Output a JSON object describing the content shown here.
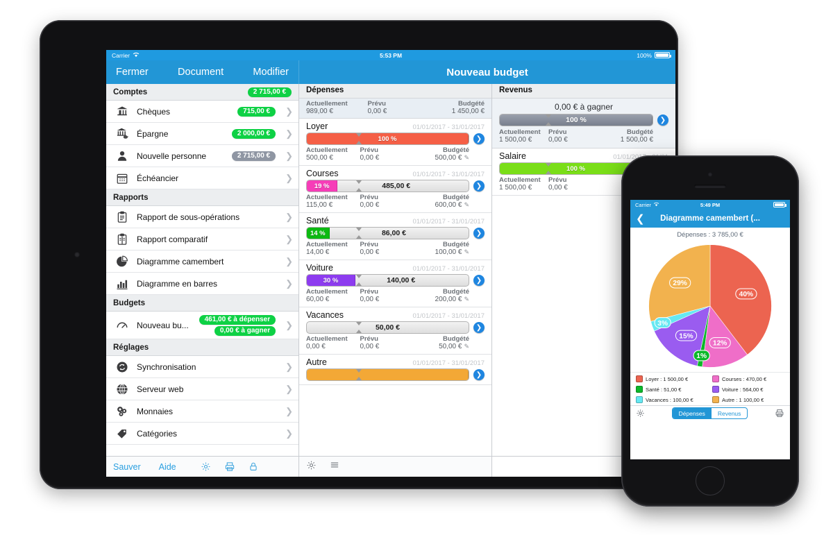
{
  "ipad": {
    "statusbar": {
      "carrier": "Carrier",
      "time": "5:53 PM",
      "battery": "100%"
    },
    "navbar": {
      "close": "Fermer",
      "document": "Document",
      "edit": "Modifier",
      "title": "Nouveau budget"
    },
    "sidebar": {
      "sections": [
        {
          "title": "Comptes",
          "badge": "2 715,00 €",
          "rows": [
            {
              "icon": "bank-icon",
              "label": "Chèques",
              "badge": "715,00 €",
              "badge_color": "green"
            },
            {
              "icon": "savings-icon",
              "label": "Épargne",
              "badge": "2 000,00 €",
              "badge_color": "green"
            },
            {
              "icon": "person-icon",
              "label": "Nouvelle personne",
              "badge": "2 715,00 €",
              "badge_color": "grey"
            },
            {
              "icon": "calendar-icon",
              "label": "Échéancier",
              "badge": "",
              "badge_color": ""
            }
          ]
        },
        {
          "title": "Rapports",
          "badge": "",
          "rows": [
            {
              "icon": "clipboard-icon",
              "label": "Rapport de sous-opérations",
              "badge": "",
              "badge_color": ""
            },
            {
              "icon": "clipboard-compare-icon",
              "label": "Rapport comparatif",
              "badge": "",
              "badge_color": ""
            },
            {
              "icon": "pie-chart-icon",
              "label": "Diagramme camembert",
              "badge": "",
              "badge_color": ""
            },
            {
              "icon": "bar-chart-icon",
              "label": "Diagramme en barres",
              "badge": "",
              "badge_color": ""
            }
          ]
        },
        {
          "title": "Budgets",
          "badge": "",
          "rows": [
            {
              "icon": "gauge-icon",
              "label": "Nouveau bu...",
              "badge": "461,00 € à dépenser",
              "badge2": "0,00 € à gagner",
              "badge_color": "green"
            }
          ]
        },
        {
          "title": "Réglages",
          "badge": "",
          "rows": [
            {
              "icon": "sync-icon",
              "label": "Synchronisation",
              "badge": "",
              "badge_color": ""
            },
            {
              "icon": "globe-icon",
              "label": "Serveur web",
              "badge": "",
              "badge_color": ""
            },
            {
              "icon": "coins-icon",
              "label": "Monnaies",
              "badge": "",
              "badge_color": ""
            },
            {
              "icon": "tag-icon",
              "label": "Catégories",
              "badge": "",
              "badge_color": ""
            }
          ]
        }
      ],
      "toolbar": {
        "save": "Sauver",
        "help": "Aide",
        "icons": [
          "gear-icon",
          "print-icon",
          "lock-icon"
        ]
      }
    },
    "expenses": {
      "title": "Dépenses",
      "labels": {
        "actual": "Actuellement",
        "planned": "Prévu",
        "budgeted": "Budgété"
      },
      "summary": {
        "actual": "989,00 €",
        "planned": "0,00 €",
        "budgeted": "1 450,00 €"
      },
      "items": [
        {
          "name": "Loyer",
          "date": "01/01/2017 - 31/01/2017",
          "percent": "100 %",
          "percent_value": 100,
          "bar_text": "",
          "color": "#ef6049",
          "actual": "500,00 €",
          "planned": "0,00 €",
          "budgeted": "500,00 €"
        },
        {
          "name": "Courses",
          "date": "01/01/2017 - 31/01/2017",
          "percent": "19 %",
          "percent_value": 19,
          "bar_text": "485,00 €",
          "color": "#ef3fb4",
          "actual": "115,00 €",
          "planned": "0,00 €",
          "budgeted": "600,00 €"
        },
        {
          "name": "Santé",
          "date": "01/01/2017 - 31/01/2017",
          "percent": "14 %",
          "percent_value": 14,
          "bar_text": "86,00 €",
          "color": "#12b817",
          "actual": "14,00 €",
          "planned": "0,00 €",
          "budgeted": "100,00 €"
        },
        {
          "name": "Voiture",
          "date": "01/01/2017 - 31/01/2017",
          "percent": "30 %",
          "percent_value": 30,
          "bar_text": "140,00 €",
          "color": "#8b3de8",
          "actual": "60,00 €",
          "planned": "0,00 €",
          "budgeted": "200,00 €"
        },
        {
          "name": "Vacances",
          "date": "01/01/2017 - 31/01/2017",
          "percent": "",
          "percent_value": 0,
          "bar_text": "50,00 €",
          "color": "#55e0f0",
          "actual": "0,00 €",
          "planned": "0,00 €",
          "budgeted": "50,00 €"
        },
        {
          "name": "Autre",
          "date": "01/01/2017 - 31/01/2017",
          "percent": "",
          "percent_value": 100,
          "bar_text": "",
          "color": "#f0a83c",
          "actual": "",
          "planned": "",
          "budgeted": ""
        }
      ]
    },
    "income": {
      "title": "Revenus",
      "gain_text": "0,00 € à gagner",
      "labels": {
        "actual": "Actuellement",
        "planned": "Prévu",
        "budgeted": "Budgété"
      },
      "summary": {
        "percent": "100 %",
        "actual": "1 500,00 €",
        "planned": "0,00 €",
        "budgeted": "1 500,00 €"
      },
      "items": [
        {
          "name": "Salaire",
          "date": "01/01/2017 - 31/01",
          "percent": "100 %",
          "percent_value": 100,
          "color": "#7ddc20",
          "actual": "1 500,00 €",
          "planned": "0,00 €",
          "budgeted": "1 500,"
        }
      ]
    }
  },
  "iphone": {
    "statusbar": {
      "carrier": "Carrier",
      "time": "5:49 PM"
    },
    "navbar": {
      "title": "Diagramme camembert (..."
    },
    "subtitle": "Dépenses : 3 785,00 €",
    "toolbar": {
      "segments": [
        "Dépenses",
        "Revenus"
      ],
      "selected": "Dépenses",
      "icons": [
        "gear-icon",
        "print-icon"
      ]
    },
    "chart_data": {
      "type": "pie",
      "title": "Dépenses : 3 785,00 €",
      "labels": [
        "Loyer",
        "Courses",
        "Santé",
        "Voiture",
        "Vacances",
        "Autre"
      ],
      "values": [
        1500.0,
        470.0,
        51.0,
        564.0,
        100.0,
        1100.0
      ],
      "percent_labels": [
        "40%",
        "12%",
        "1%",
        "15%",
        "3%",
        "29%"
      ],
      "colors": [
        "#ec6450",
        "#ef6ec8",
        "#0cb82a",
        "#9a5cf0",
        "#66e8f2",
        "#f2b24e"
      ],
      "legend": [
        {
          "label": "Loyer : 1 500,00 €",
          "color": "#ec6450"
        },
        {
          "label": "Courses : 470,00 €",
          "color": "#ef6ec8"
        },
        {
          "label": "Santé : 51,00 €",
          "color": "#0cb82a"
        },
        {
          "label": "Voiture : 564,00 €",
          "color": "#9a5cf0"
        },
        {
          "label": "Vacances : 100,00 €",
          "color": "#66e8f2"
        },
        {
          "label": "Autre : 1 100,00 €",
          "color": "#f2b24e"
        }
      ],
      "legend_position": "bottom"
    }
  }
}
